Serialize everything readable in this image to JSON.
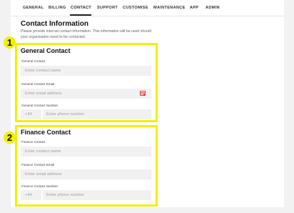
{
  "nav": {
    "items": [
      "GENERAL",
      "BILLING",
      "CONTACT",
      "SUPPORT",
      "CUSTOMISE",
      "MAINTENANCE",
      "APP",
      "ADMIN"
    ],
    "active": "CONTACT"
  },
  "page": {
    "title": "Contact Information",
    "description": "Please provide internal contact information. This information will be used should your organisation need to be contacted."
  },
  "annotations": {
    "one": "1",
    "two": "2"
  },
  "general": {
    "title": "General Contact",
    "name_label": "General Contact",
    "name_placeholder": "Enter contact name",
    "email_label": "General Contact Email",
    "email_placeholder": "Enter email address",
    "phone_label": "General Contact Number",
    "phone_code": "+44",
    "phone_placeholder": "Enter phone number"
  },
  "finance": {
    "title": "Finance Contact",
    "name_label": "Finance Contact",
    "name_placeholder": "Enter contact name",
    "email_label": "Finance Contact Email",
    "email_placeholder": "Enter email address",
    "phone_label": "Finance Contact Number",
    "phone_code": "+44",
    "phone_placeholder": "Enter phone number"
  },
  "colors": {
    "highlight": "#f2ef06",
    "error": "#e23b3b"
  },
  "icons": {
    "email_error": "email-error-icon"
  }
}
